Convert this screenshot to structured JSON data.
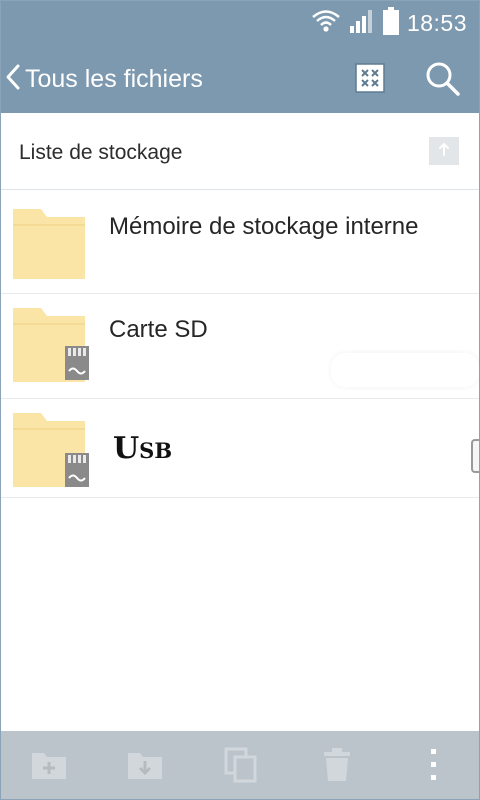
{
  "status_bar": {
    "time": "18:53",
    "icons": [
      "wifi-icon",
      "signal-icon",
      "battery-icon"
    ]
  },
  "action_bar": {
    "back_label": "Tous les fichiers",
    "icons": [
      "grid-view-icon",
      "search-icon"
    ]
  },
  "sub_header": {
    "title": "Liste de stockage",
    "up_icon": "up-arrow-icon"
  },
  "storage_list": [
    {
      "label": "Mémoire de stockage interne",
      "icon": "folder-icon",
      "badge": ""
    },
    {
      "label": "Carte SD",
      "icon": "folder-icon",
      "badge": "sd-card-icon"
    },
    {
      "label": "Usb",
      "icon": "folder-icon",
      "badge": "sd-card-icon"
    }
  ],
  "bottom_bar": {
    "icons": [
      "new-folder-icon",
      "download-folder-icon",
      "copy-icon",
      "delete-icon",
      "more-icon"
    ]
  },
  "colors": {
    "bar": "#7d99af",
    "bottom_bar": "#bcc4cb",
    "folder": "#fbe5a6"
  }
}
